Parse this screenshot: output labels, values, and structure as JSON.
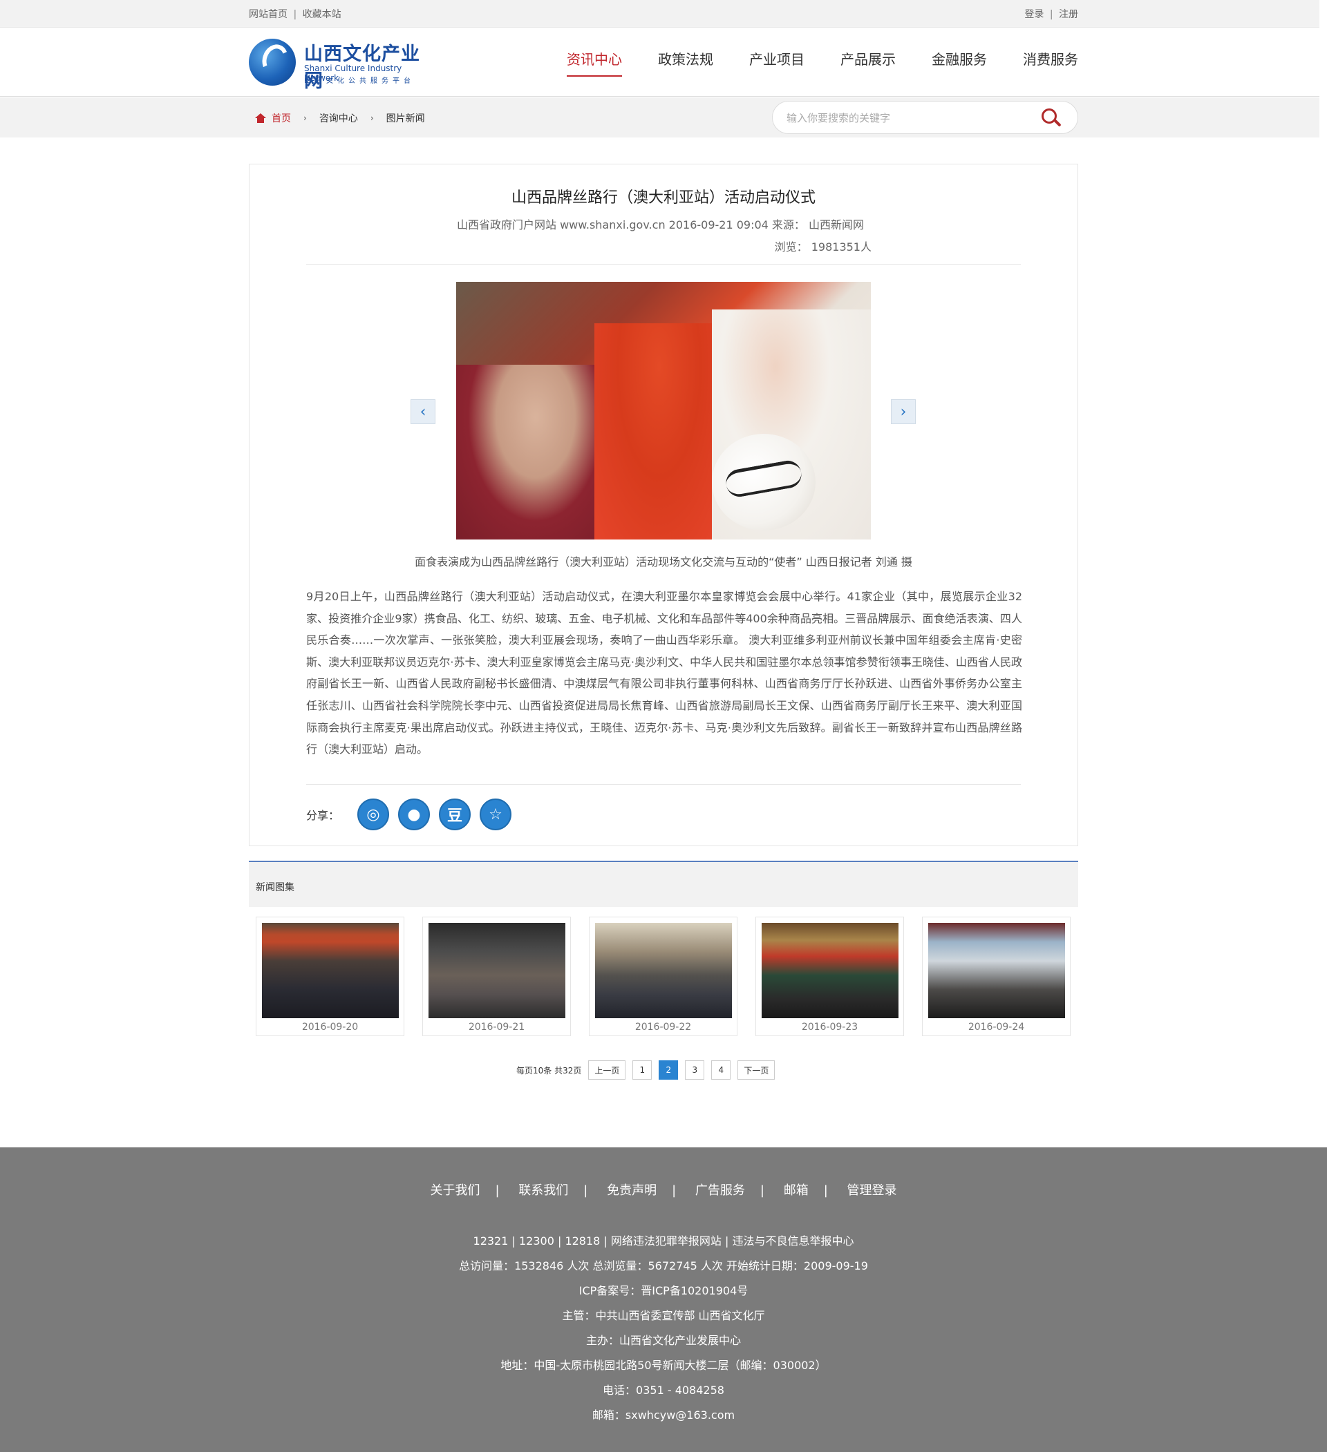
{
  "topbar": {
    "home_link": "网站首页",
    "bookmark_link": "收藏本站",
    "login": "登录",
    "register": "注册",
    "separator": "|"
  },
  "logo": {
    "title_cn": "山西文化产业网",
    "title_en": "Shanxi Culture Industry Network",
    "subtitle": "山西文化公共服务平台"
  },
  "nav": {
    "items": [
      "资讯中心",
      "政策法规",
      "产业项目",
      "产品展示",
      "金融服务",
      "消费服务"
    ],
    "active_index": 0
  },
  "breadcrumb": {
    "home": "首页",
    "level1": "咨询中心",
    "level2": "图片新闻",
    "separator": "›",
    "home_icon": "home-icon"
  },
  "search": {
    "placeholder": "输入你要搜索的关键字",
    "icon": "search-icon"
  },
  "article": {
    "title": "山西品牌丝路行（澳大利亚站）活动启动仪式",
    "meta": "山西省政府门户网站 www.shanxi.gov.cn 2016-09-21 09:04 来源： 山西新闻网",
    "views": "浏览： 1981351人",
    "prev_icon": "‹",
    "next_icon": "›",
    "caption": "面食表演成为山西品牌丝路行（澳大利亚站）活动现场文化交流与互动的“使者” 山西日报记者 刘通 摄",
    "body": "9月20日上午，山西品牌丝路行（澳大利亚站）活动启动仪式，在澳大利亚墨尔本皇家博览会会展中心举行。41家企业（其中，展览展示企业32家、投资推介企业9家）携食品、化工、纺织、玻璃、五金、电子机械、文化和车品部件等400余种商品亮相。三晋品牌展示、面食绝活表演、四人民乐合奏……一次次掌声、一张张笑脸，澳大利亚展会现场，奏响了一曲山西华彩乐章。 澳大利亚维多利亚州前议长兼中国年组委会主席肯·史密斯、澳大利亚联邦议员迈克尔·苏卡、澳大利亚皇家博览会主席马克·奥沙利文、中华人民共和国驻墨尔本总领事馆参赞衔领事王晓佳、山西省人民政府副省长王一新、山西省人民政府副秘书长盛佃清、中澳煤层气有限公司非执行董事何科林、山西省商务厅厅长孙跃进、山西省外事侨务办公室主任张志川、山西省社会科学院院长李中元、山西省投资促进局局长焦育峰、山西省旅游局副局长王文保、山西省商务厅副厅长王来平、澳大利亚国际商会执行主席麦克·果出席启动仪式。孙跃进主持仪式，王晓佳、迈克尔·苏卡、马克·奥沙利文先后致辞。副省长王一新致辞并宣布山西品牌丝路行（澳大利亚站）启动。"
  },
  "share": {
    "label": "分享：",
    "buttons": [
      {
        "name": "weibo-icon",
        "glyph": "◎"
      },
      {
        "name": "wechat-icon",
        "glyph": "●"
      },
      {
        "name": "douban-icon",
        "glyph": "豆"
      },
      {
        "name": "qzone-icon",
        "glyph": "☆"
      }
    ]
  },
  "gallery": {
    "label": "新闻图集",
    "items": [
      {
        "date": "2016-09-20"
      },
      {
        "date": "2016-09-21"
      },
      {
        "date": "2016-09-22"
      },
      {
        "date": "2016-09-23"
      },
      {
        "date": "2016-09-24"
      }
    ]
  },
  "pager": {
    "info": "每页10条 共32页",
    "prev": "上一页",
    "pages": [
      "1",
      "2",
      "3",
      "4"
    ],
    "current": "2",
    "next": "下一页"
  },
  "footer": {
    "links": [
      "关于我们",
      "联系我们",
      "免责声明",
      "广告服务",
      "邮箱",
      "管理登录"
    ],
    "lines": [
      "12321 | 12300 | 12818 | 网络违法犯罪举报网站 | 违法与不良信息举报中心",
      "总访问量：1532846 人次  总浏览量：5672745 人次  开始统计日期：2009-09-19",
      "ICP备案号：晋ICP备10201904号",
      "主管：中共山西省委宣传部 山西省文化厅",
      "主办：山西省文化产业发展中心",
      "地址：中国-太原市桃园北路50号新闻大楼二层（邮编：030002）",
      "电话：0351 - 4084258",
      "邮箱：sxwhcyw@163.com"
    ]
  },
  "colors": {
    "accent_red": "#c1272d",
    "accent_blue": "#2a84d1",
    "footer_bg": "#7b7b7b"
  }
}
